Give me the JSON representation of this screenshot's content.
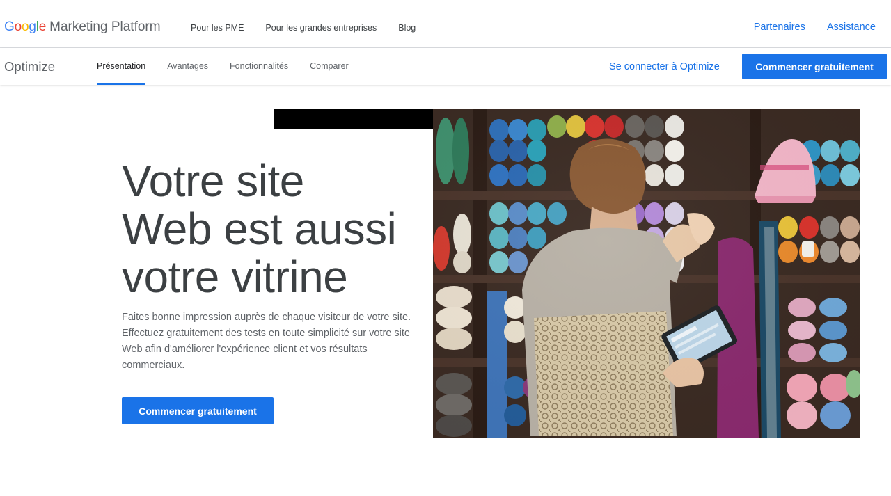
{
  "header": {
    "logo_google": "Google",
    "logo_rest": "Marketing Platform",
    "nav": [
      "Pour les PME",
      "Pour les grandes entreprises",
      "Blog"
    ],
    "right_links": [
      "Partenaires",
      "Assistance"
    ]
  },
  "subnav": {
    "product": "Optimize",
    "tabs": [
      "Présentation",
      "Avantages",
      "Fonctionnalités",
      "Comparer"
    ],
    "active_tab": "Présentation",
    "signin_label": "Se connecter à Optimize",
    "cta_label": "Commencer gratuitement"
  },
  "hero": {
    "title_lines": [
      "Votre site",
      "Web est aussi",
      "votre vitrine"
    ],
    "description": "Faites bonne impression auprès de chaque visiteur de votre site. Effectuez gratuitement des tests en toute simplicité sur votre site Web afin d'améliorer l'expérience client et vos résultats commerciaux.",
    "cta_label": "Commencer gratuitement",
    "image_alt": "woman-browsing-yarn-shop-with-tablet"
  },
  "colors": {
    "accent": "#1a73e8",
    "text": "#3c4043",
    "google_blue": "#4285f4",
    "google_red": "#ea4335",
    "google_yellow": "#fbbc05",
    "google_green": "#34a853"
  }
}
